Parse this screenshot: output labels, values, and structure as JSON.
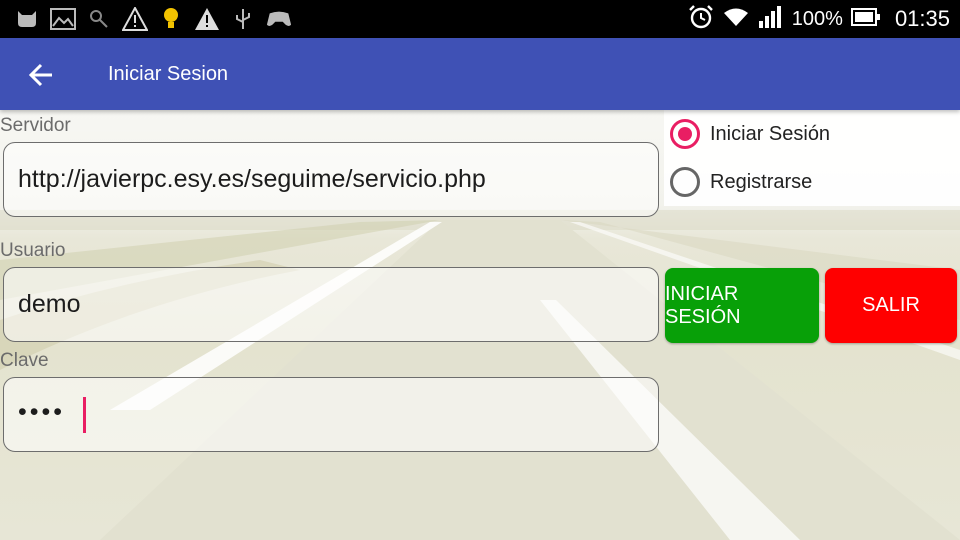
{
  "status_bar": {
    "battery": "100%",
    "time": "01:35",
    "icons": [
      "android-cat-icon",
      "image-icon",
      "key-icon",
      "warning-icon",
      "bulb-icon",
      "warning-icon",
      "usb-icon",
      "android-gamepad-icon",
      "alarm-icon",
      "wifi-icon",
      "signal-icon",
      "battery-icon"
    ]
  },
  "app_bar": {
    "title": "Iniciar Sesion",
    "back_icon": "arrow-left-icon"
  },
  "form": {
    "servidor_label": "Servidor",
    "servidor_value": "http://javierpc.esy.es/seguime/servicio.php",
    "usuario_label": "Usuario",
    "usuario_value": "demo",
    "clave_label": "Clave",
    "clave_value": "••••"
  },
  "mode": {
    "options": [
      {
        "label": "Iniciar Sesión",
        "selected": true
      },
      {
        "label": "Registrarse",
        "selected": false
      }
    ]
  },
  "buttons": {
    "login": "INICIAR SESIÓN",
    "exit": "SALIR"
  },
  "colors": {
    "app_bar": "#3f51b5",
    "accent": "#e91e63",
    "login": "#08a008",
    "exit": "#ff0000"
  }
}
